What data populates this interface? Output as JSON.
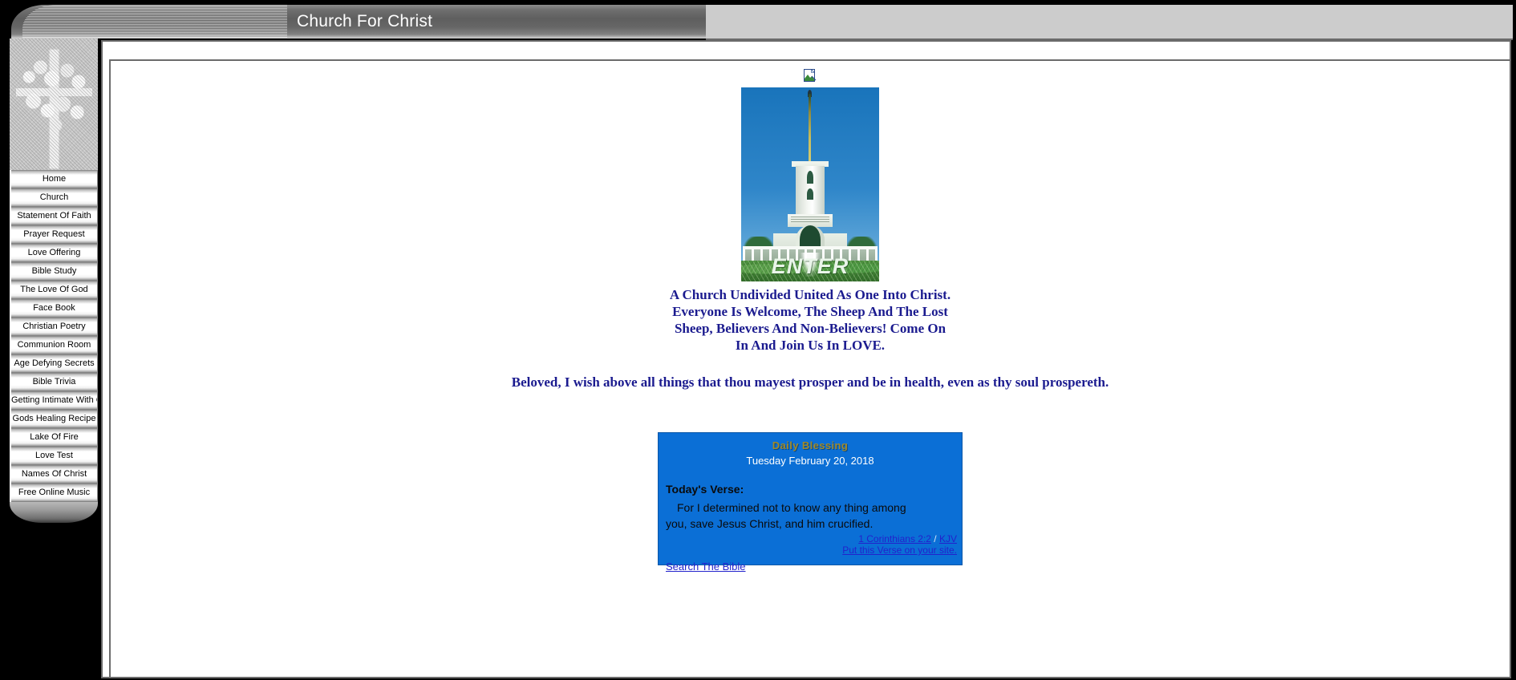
{
  "header": {
    "title": "Church For Christ"
  },
  "sidebar": {
    "emblem_name": "cross-with-flowers",
    "items": [
      {
        "label": "Home"
      },
      {
        "label": "Church"
      },
      {
        "label": "Statement Of Faith"
      },
      {
        "label": "Prayer Request"
      },
      {
        "label": "Love Offering"
      },
      {
        "label": "Bible Study"
      },
      {
        "label": "The Love Of God"
      },
      {
        "label": "Face Book"
      },
      {
        "label": "Christian Poetry"
      },
      {
        "label": "Communion Room"
      },
      {
        "label": "Age Defying Secrets"
      },
      {
        "label": "Bible Trivia"
      },
      {
        "label": "Getting Intimate With God"
      },
      {
        "label": "Gods Healing Recipe"
      },
      {
        "label": "Lake Of Fire"
      },
      {
        "label": "Love Test"
      },
      {
        "label": "Names Of Christ"
      },
      {
        "label": "Free Online Music"
      }
    ]
  },
  "main": {
    "broken_image_alt": "",
    "temple": {
      "enter_label": "ENTER"
    },
    "welcome_lines": [
      "A Church Undivided United As One Into Christ.",
      "Everyone Is Welcome, The Sheep And The Lost",
      "Sheep, Believers And Non-Believers! Come On",
      "In And Join Us In LOVE."
    ],
    "scripture_line": "Beloved, I wish above all things that thou mayest prosper and be in health, even as thy soul prospereth.",
    "blessing": {
      "title": "Daily Blessing",
      "date": "Tuesday February 20, 2018",
      "verse_heading": "Today's Verse:",
      "verse_line1": "For I determined not to know any thing among",
      "verse_line2": "you, save Jesus Christ, and him crucified.",
      "reference_link": "1 Corinthians 2:2",
      "reference_separator": " / ",
      "translation_link": "KJV",
      "promo_link": "Put this Verse on your site.",
      "search_link": "Search The Bible"
    }
  },
  "colors": {
    "header_text": "#ffffff",
    "nav_text": "#000000",
    "scripture_blue": "#1b1b8f",
    "blessing_bg": "#0b6fd6",
    "blessing_title_gold": "#a08a2a",
    "link_blue": "#2222cc"
  }
}
